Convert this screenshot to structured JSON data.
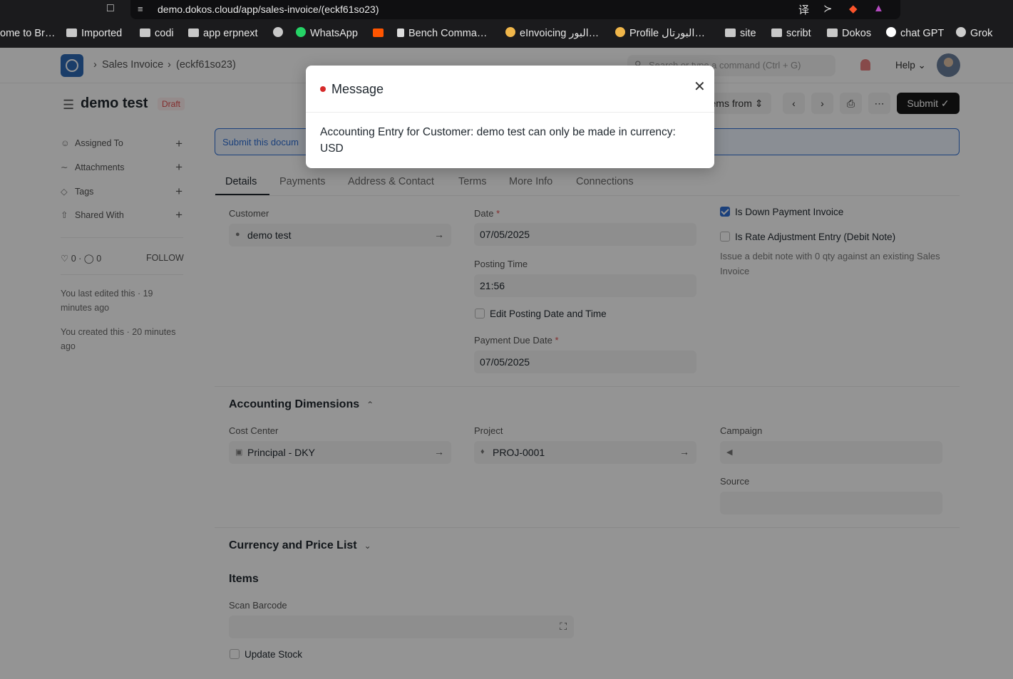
{
  "browser": {
    "url": "demo.dokos.cloud/app/sales-invoice/(eckf61so23)",
    "bookmarks": [
      {
        "label": "ome to Br…",
        "icon": "none"
      },
      {
        "label": "Imported",
        "icon": "folder-icon"
      },
      {
        "label": "codi",
        "icon": "folder-icon"
      },
      {
        "label": "app erpnext",
        "icon": "folder-icon"
      },
      {
        "label": "",
        "icon": "globe-icon"
      },
      {
        "label": "WhatsApp",
        "icon": "whatsapp-icon"
      },
      {
        "label": "",
        "icon": "soundcloud-icon"
      },
      {
        "label": "Bench Comma…",
        "icon": "frappe-icon"
      },
      {
        "label": "eInvoicing البور…",
        "icon": "emoji-icon"
      },
      {
        "label": "Profile البورتال…",
        "icon": "emoji-icon"
      },
      {
        "label": "site",
        "icon": "folder-icon"
      },
      {
        "label": "scribt",
        "icon": "folder-icon"
      },
      {
        "label": "Dokos",
        "icon": "folder-icon"
      },
      {
        "label": "chat GPT",
        "icon": "openai-icon"
      },
      {
        "label": "Grok",
        "icon": "grok-icon"
      }
    ]
  },
  "navbar": {
    "breadcrumb_1": "Sales Invoice",
    "breadcrumb_2": "(eckf61so23)",
    "search_placeholder": "Search or type a command (Ctrl + G)",
    "help_label": "Help"
  },
  "header": {
    "title": "demo test",
    "status": "Draft",
    "get_items_label": "ems from",
    "submit_label": "Submit"
  },
  "sidebar": {
    "items": [
      {
        "label": "Assigned To"
      },
      {
        "label": "Attachments"
      },
      {
        "label": "Tags"
      },
      {
        "label": "Shared With"
      }
    ],
    "likes": "0",
    "comments": "0",
    "follow": "FOLLOW",
    "last_edited": "You last edited this · 19 minutes ago",
    "created": "You created this · 20 minutes ago"
  },
  "alert": {
    "text": "Submit this docum"
  },
  "tabs": [
    "Details",
    "Payments",
    "Address & Contact",
    "Terms",
    "More Info",
    "Connections"
  ],
  "form": {
    "customer_label": "Customer",
    "customer_value": "demo test",
    "date_label": "Date",
    "date_value": "07/05/2025",
    "posting_time_label": "Posting Time",
    "posting_time_value": "21:56",
    "edit_posting_label": "Edit Posting Date and Time",
    "due_date_label": "Payment Due Date",
    "due_date_value": "07/05/2025",
    "down_payment_label": "Is Down Payment Invoice",
    "rate_adj_label": "Is Rate Adjustment Entry (Debit Note)",
    "rate_adj_help": "Issue a debit note with 0 qty against an existing Sales Invoice"
  },
  "accounting": {
    "title": "Accounting Dimensions",
    "cost_center_label": "Cost Center",
    "cost_center_value": "Principal - DKY",
    "project_label": "Project",
    "project_value": "PROJ-0001",
    "campaign_label": "Campaign",
    "source_label": "Source"
  },
  "currency": {
    "title": "Currency and Price List"
  },
  "items": {
    "title": "Items",
    "scan_label": "Scan Barcode",
    "update_stock_label": "Update Stock"
  },
  "modal": {
    "title": "Message",
    "body": "Accounting Entry for Customer: demo test can only be made in currency: USD"
  }
}
